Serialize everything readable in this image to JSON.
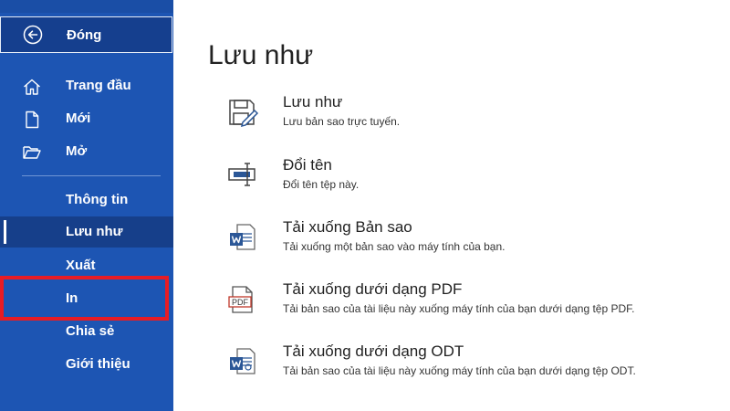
{
  "sidebar": {
    "back": {
      "label": "Đóng",
      "icon": "back-arrow-icon"
    },
    "items": [
      {
        "key": "home",
        "label": "Trang đầu",
        "icon": "home-icon"
      },
      {
        "key": "new",
        "label": "Mới",
        "icon": "new-document-icon"
      },
      {
        "key": "open",
        "label": "Mở",
        "icon": "folder-open-icon"
      },
      {
        "key": "info",
        "label": "Thông tin"
      },
      {
        "key": "save-as",
        "label": "Lưu như",
        "selected": true
      },
      {
        "key": "export",
        "label": "Xuất"
      },
      {
        "key": "print",
        "label": "In",
        "highlighted": true
      },
      {
        "key": "share",
        "label": "Chia sẻ"
      },
      {
        "key": "about",
        "label": "Giới thiệu"
      }
    ]
  },
  "main": {
    "title": "Lưu như",
    "options": [
      {
        "title": "Lưu như",
        "description": "Lưu bản sao trực tuyến.",
        "icon": "save-as-icon"
      },
      {
        "title": "Đổi tên",
        "description": "Đổi tên tệp này.",
        "icon": "rename-icon"
      },
      {
        "title": "Tải xuống Bản sao",
        "description": "Tải xuống một bản sao vào máy tính của bạn.",
        "icon": "word-document-icon"
      },
      {
        "title": "Tải xuống dưới dạng PDF",
        "description": "Tải bản sao của tài liệu này xuống máy tính của bạn dưới dạng tệp PDF.",
        "icon": "pdf-file-icon",
        "icon_text": "PDF"
      },
      {
        "title": "Tải xuống dưới dạng ODT",
        "description": "Tải bản sao của tài liệu này xuống máy tính của bạn dưới dạng tệp ODT.",
        "icon": "odt-document-icon"
      }
    ]
  },
  "colors": {
    "sidebar_bg": "#1d55b3",
    "selected_bg": "#163f8a",
    "highlight_border": "#e81c24",
    "word_blue": "#2b5797"
  }
}
